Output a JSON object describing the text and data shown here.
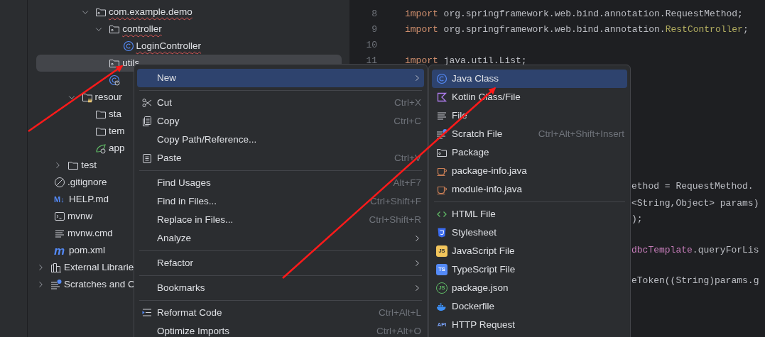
{
  "project_tree": [
    {
      "children": [
        {
          "children": [
            {
              "children": [
                {
                  "children": [
                    {
                      "kind": "package",
                      "label": "com.example.demo",
                      "expanded": true,
                      "error": true,
                      "selected": false,
                      "children": [
                        {
                          "kind": "package",
                          "label": "controller",
                          "expanded": true,
                          "error": true,
                          "selected": false,
                          "children": [
                            {
                              "kind": "class",
                              "label": "LoginController",
                              "error": true,
                              "selected": false
                            }
                          ]
                        },
                        {
                          "kind": "package",
                          "label": "utils",
                          "error": false,
                          "selected": true
                        },
                        {
                          "kind": "spring-class",
                          "selected": false
                        }
                      ]
                    }
                  ]
                },
                {
                  "kind": "resources",
                  "label": "resour",
                  "expanded": true,
                  "error": false,
                  "selected": false,
                  "children": [
                    {
                      "kind": "folder",
                      "label": "sta",
                      "error": false,
                      "selected": false
                    },
                    {
                      "kind": "folder",
                      "label": "tem",
                      "error": false,
                      "selected": false
                    },
                    {
                      "kind": "spring-config",
                      "label": "app",
                      "error": false,
                      "selected": false
                    }
                  ]
                }
              ]
            },
            {
              "kind": "folder",
              "label": "test",
              "expanded": false,
              "error": false,
              "selected": false
            }
          ]
        },
        {
          "kind": "ignore",
          "label": ".gitignore",
          "error": false,
          "selected": false
        },
        {
          "kind": "markdown",
          "label": "HELP.md",
          "badge": "M↓",
          "error": false,
          "selected": false
        },
        {
          "kind": "shell",
          "label": "mvnw",
          "error": false,
          "selected": false
        },
        {
          "kind": "text",
          "label": "mvnw.cmd",
          "error": false,
          "selected": false
        },
        {
          "kind": "maven",
          "label": "pom.xml",
          "badge": "m",
          "error": false,
          "selected": false
        }
      ]
    },
    {
      "kind": "libraries",
      "label": "External Librarie",
      "expanded": false,
      "error": false,
      "selected": false
    },
    {
      "kind": "scratches",
      "label": "Scratches and C",
      "expanded": false,
      "error": false,
      "selected": false
    }
  ],
  "code_lines": [
    {
      "number": "8",
      "tokens": [
        {
          "kind": "keyword",
          "text": "import"
        },
        {
          "kind": "plain",
          "text": " org.springframework.web.bind.annotation.RequestMethod;"
        }
      ]
    },
    {
      "number": "9",
      "tokens": [
        {
          "kind": "keyword",
          "text": "import"
        },
        {
          "kind": "plain",
          "text": " org.springframework.web.bind.annotation."
        },
        {
          "kind": "annotation",
          "text": "RestController"
        },
        {
          "kind": "plain",
          "text": ";"
        }
      ]
    },
    {
      "number": "10"
    },
    {
      "number": "11",
      "tokens": [
        {
          "kind": "keyword",
          "text": "import"
        },
        {
          "kind": "plain",
          "text": " java.util.List;"
        }
      ]
    }
  ],
  "code_fragments": [
    {
      "tokens": [
        {
          "kind": "plain",
          "text": "ethod = RequestMethod."
        }
      ]
    },
    {
      "tokens": [
        {
          "kind": "plain",
          "text": "<String,Object> params)"
        }
      ]
    },
    {
      "tokens": [
        {
          "kind": "plain",
          "text": ");"
        }
      ]
    },
    {
      "tokens": [
        {
          "kind": "field",
          "text": "dbcTemplate"
        },
        {
          "kind": "plain",
          "text": ".queryForLis"
        }
      ]
    },
    {
      "tokens": [
        {
          "kind": "plain",
          "text": "eToken((String)params.g"
        }
      ]
    }
  ],
  "context_menu": [
    {
      "kind": "item",
      "label": "New",
      "submenu": true,
      "selected": true
    },
    {
      "kind": "separator"
    },
    {
      "kind": "cut",
      "label": "Cut",
      "shortcut": "Ctrl+X",
      "selected": false
    },
    {
      "kind": "copy",
      "label": "Copy",
      "shortcut": "Ctrl+C",
      "selected": false
    },
    {
      "kind": "item",
      "label": "Copy Path/Reference...",
      "selected": false
    },
    {
      "kind": "paste",
      "label": "Paste",
      "shortcut": "Ctrl+V",
      "selected": false
    },
    {
      "kind": "separator"
    },
    {
      "kind": "item",
      "label": "Find Usages",
      "shortcut": "Alt+F7",
      "selected": false
    },
    {
      "kind": "item",
      "label": "Find in Files...",
      "shortcut": "Ctrl+Shift+F",
      "selected": false
    },
    {
      "kind": "item",
      "label": "Replace in Files...",
      "shortcut": "Ctrl+Shift+R",
      "selected": false
    },
    {
      "kind": "item",
      "label": "Analyze",
      "submenu": true,
      "selected": false
    },
    {
      "kind": "separator"
    },
    {
      "kind": "item",
      "label": "Refactor",
      "submenu": true,
      "selected": false
    },
    {
      "kind": "separator"
    },
    {
      "kind": "item",
      "label": "Bookmarks",
      "submenu": true,
      "selected": false
    },
    {
      "kind": "separator"
    },
    {
      "kind": "reformat",
      "label": "Reformat Code",
      "shortcut": "Ctrl+Alt+L",
      "selected": false
    },
    {
      "kind": "item",
      "label": "Optimize Imports",
      "shortcut": "Ctrl+Alt+O",
      "selected": false
    }
  ],
  "new_submenu": [
    {
      "kind": "class",
      "label": "Java Class",
      "selected": true
    },
    {
      "kind": "kotlin",
      "label": "Kotlin Class/File",
      "selected": false
    },
    {
      "kind": "file",
      "label": "File",
      "selected": false
    },
    {
      "kind": "scratch",
      "label": "Scratch File",
      "shortcut": "Ctrl+Alt+Shift+Insert",
      "selected": false
    },
    {
      "kind": "package",
      "label": "Package",
      "selected": false
    },
    {
      "kind": "java",
      "label": "package-info.java",
      "selected": false
    },
    {
      "kind": "java",
      "label": "module-info.java",
      "selected": false
    },
    {
      "kind": "separator"
    },
    {
      "kind": "html",
      "label": "HTML File",
      "selected": false
    },
    {
      "kind": "css",
      "label": "Stylesheet",
      "selected": false
    },
    {
      "kind": "js",
      "badge": "JS",
      "label": "JavaScript File",
      "selected": false
    },
    {
      "kind": "ts",
      "badge": "TS",
      "label": "TypeScript File",
      "selected": false
    },
    {
      "kind": "npm",
      "badge": "JS",
      "label": "package.json",
      "selected": false
    },
    {
      "kind": "docker",
      "label": "Dockerfile",
      "selected": false
    },
    {
      "kind": "api",
      "badge": "API",
      "label": "HTTP Request",
      "selected": false
    }
  ]
}
